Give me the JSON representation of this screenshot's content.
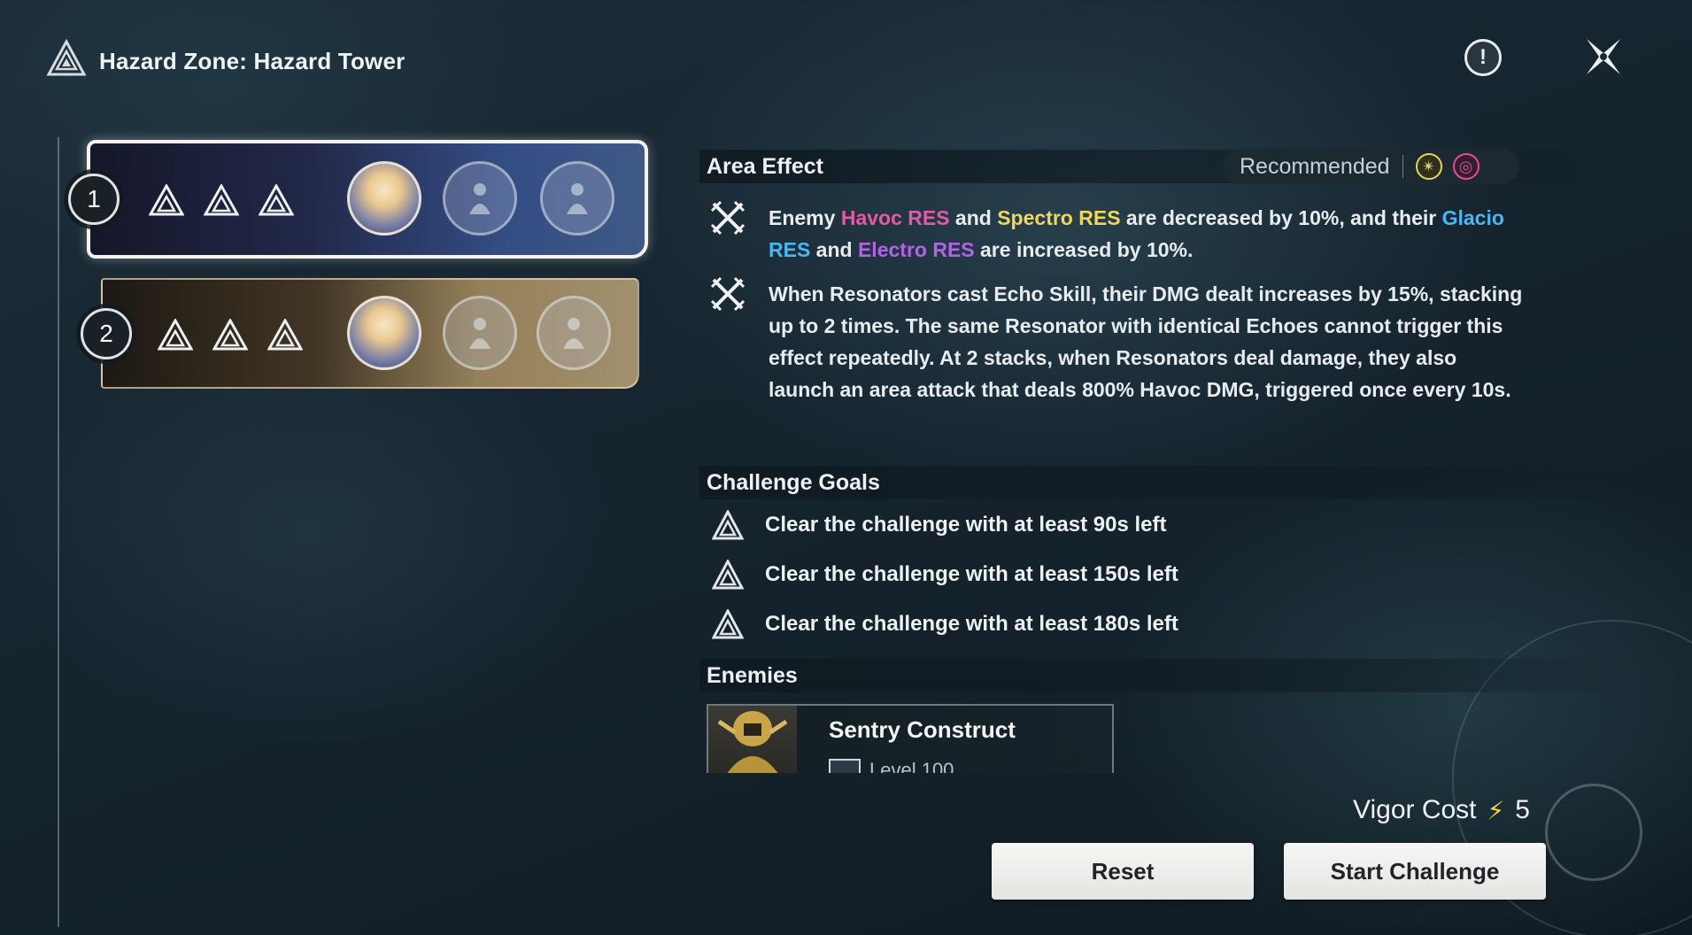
{
  "header": {
    "title": "Hazard Zone: Hazard Tower",
    "info_glyph": "!"
  },
  "stages": [
    {
      "number": "1",
      "stars": 3,
      "team": [
        "filled",
        "empty",
        "empty"
      ],
      "selected": true
    },
    {
      "number": "2",
      "stars": 3,
      "team": [
        "filled",
        "empty",
        "empty"
      ],
      "selected": false
    }
  ],
  "area_effect": {
    "heading": "Area Effect",
    "recommended_label": "Recommended",
    "recommended_elements": [
      {
        "name": "spectro-icon",
        "glyph": "✴",
        "color": "#e7d25a"
      },
      {
        "name": "havoc-icon",
        "glyph": "◎",
        "color": "#e04f8e"
      }
    ],
    "effect1": {
      "t1": "Enemy ",
      "havoc": "Havoc RES",
      "t2": " and ",
      "spectro": "Spectro RES",
      "t3": " are decreased by 10%, and their ",
      "glacio": "Glacio RES",
      "t4": " and ",
      "electro": "Electro RES",
      "t5": " are increased by 10%."
    },
    "effect2": "When Resonators cast Echo Skill, their DMG dealt increases by 15%, stacking up to 2 times. The same Resonator with identical Echoes cannot trigger this effect repeatedly. At 2 stacks, when Resonators deal damage, they also launch an area attack that deals 800% Havoc DMG, triggered once every 10s."
  },
  "challenge_goals": {
    "heading": "Challenge Goals",
    "items": [
      "Clear the challenge with at least 90s left",
      "Clear the challenge with at least 150s left",
      "Clear the challenge with at least 180s left"
    ]
  },
  "enemies": {
    "heading": "Enemies",
    "list": [
      {
        "name": "Sentry Construct",
        "level": "Level 100"
      }
    ]
  },
  "footer": {
    "vigor_label": "Vigor Cost",
    "vigor_value": "5",
    "reset_label": "Reset",
    "start_label": "Start Challenge"
  },
  "colors": {
    "havoc": "#e45aa6",
    "spectro": "#f0d65a",
    "glacio": "#4ab6f2",
    "electro": "#b462e8"
  }
}
